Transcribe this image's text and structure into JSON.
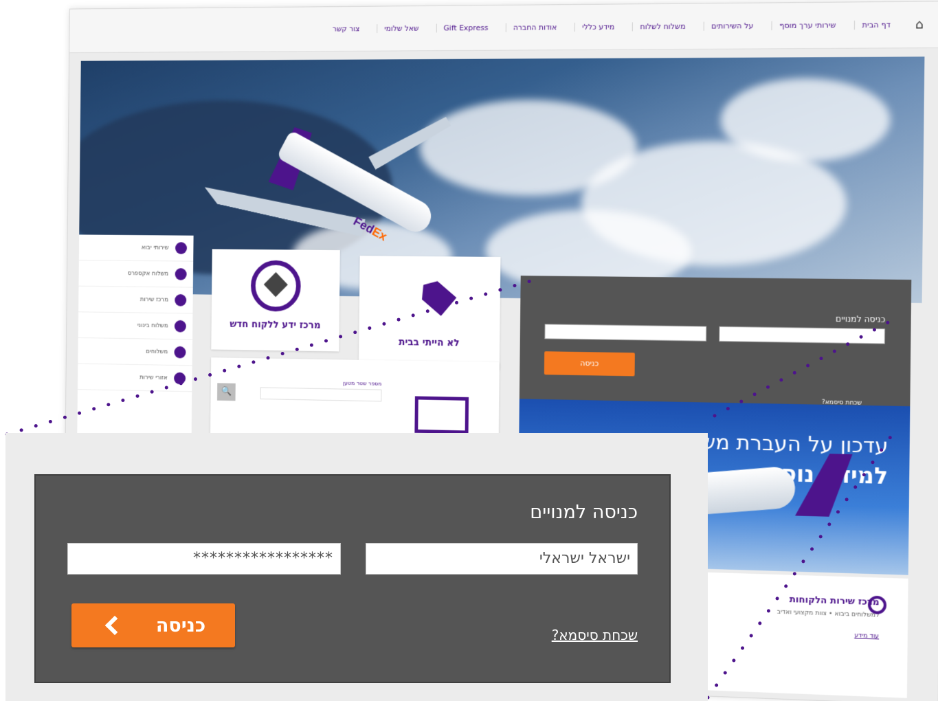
{
  "background_page": {
    "topnav": {
      "items": [
        "דף הבית",
        "שירותי ערך מוסף",
        "על השירותים",
        "משלוח לשלוח",
        "מידע כללי",
        "אודות החברה",
        "Gift Express",
        "שאל שלומי",
        "צור קשר"
      ]
    },
    "hero": {
      "logo_main": "Fed",
      "logo_accent": "Ex"
    },
    "sidebar": {
      "items": [
        "שירותי יבוא",
        "משלוח אקספרס",
        "מרכז שירות",
        "משלוח בינוני",
        "משלוחים",
        "אזורי שירות"
      ]
    },
    "tiles": {
      "tile1_label": "מרכז ידע ללקוח חדש",
      "tile2_label": "לא הייתי בבית",
      "search_label": "מספר שטר מטען",
      "search_button": "🔍"
    },
    "mini_login": {
      "title": "כניסה למנויים",
      "button": "כניסה",
      "forgot": "שכחת סיסמא?"
    },
    "promo": {
      "line1": "עדכון על העברת משלוח",
      "line2": "למידע נוסף"
    },
    "support": {
      "title": "מרכז שירות הלקוחות",
      "text": "למשלוחים ביבוא • צוות מקצועי ואדיב",
      "link": "עוד מידע"
    }
  },
  "login_panel": {
    "title": "כניסה למנויים",
    "username_value": "ישראל ישראלי",
    "password_value": "*****************",
    "submit_label": "כניסה",
    "forgot_password_label": "שכחת סיסמא?"
  },
  "colors": {
    "panel_background": "#555555",
    "button_orange": "#f47920",
    "brand_purple": "#4d148c",
    "frame_gray": "#ececec"
  }
}
